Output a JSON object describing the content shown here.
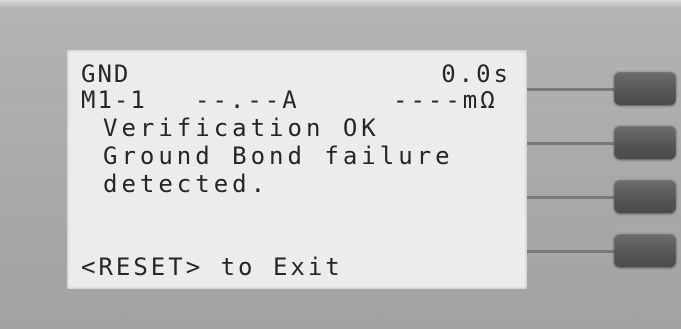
{
  "display": {
    "mode": "GND",
    "timer": "0.0s",
    "step": "M1-1",
    "current": "--.--A",
    "resistance": "----mΩ",
    "line3": "Verification OK",
    "line4": "Ground Bond failure",
    "line5": "detected.",
    "exit_hint": "<RESET> to Exit"
  },
  "softkeys": [
    {
      "id": "softkey-1"
    },
    {
      "id": "softkey-2"
    },
    {
      "id": "softkey-3"
    },
    {
      "id": "softkey-4"
    }
  ],
  "colors": {
    "lcd_background": "#ececec",
    "lcd_text": "#262626",
    "panel": "#ababab",
    "softkey": "#5a5a5a"
  }
}
